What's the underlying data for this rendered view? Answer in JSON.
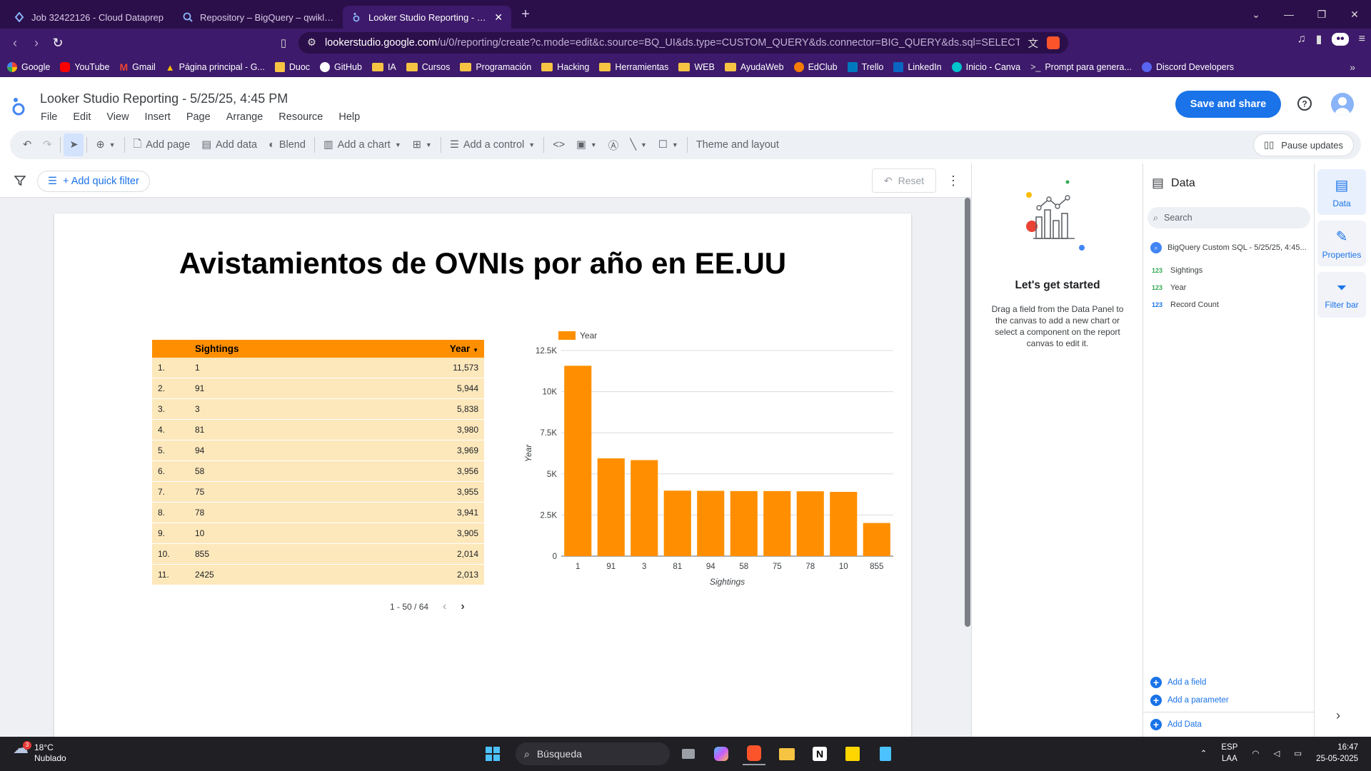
{
  "browser": {
    "tabs": [
      {
        "title": "Job 32422126 - Cloud Dataprep",
        "active": false
      },
      {
        "title": "Repository – BigQuery – qwiklabs-g",
        "active": false
      },
      {
        "title": "Looker Studio Reporting - 5/25",
        "active": true
      }
    ],
    "url_host": "lookerstudio.google.com",
    "url_path": "/u/0/reporting/create?c.mode=edit&c.source=BQ_UI&ds.type=CUSTOM_QUERY&ds.connector=BIG_QUERY&ds.sql=SELECT%20...",
    "bookmarks": [
      "Google",
      "YouTube",
      "Gmail",
      "Página principal - G...",
      "Duoc",
      "GitHub",
      "IA",
      "Cursos",
      "Programación",
      "Hacking",
      "Herramientas",
      "WEB",
      "AyudaWeb",
      "EdClub",
      "Trello",
      "LinkedIn",
      "Inicio - Canva",
      "Prompt para genera...",
      "Discord Developers"
    ]
  },
  "app": {
    "title": "Looker Studio Reporting - 5/25/25, 4:45 PM",
    "menu": [
      "File",
      "Edit",
      "View",
      "Insert",
      "Page",
      "Arrange",
      "Resource",
      "Help"
    ],
    "save_label": "Save and share"
  },
  "toolbar": {
    "add_page": "Add page",
    "add_data": "Add data",
    "blend": "Blend",
    "add_chart": "Add a chart",
    "add_control": "Add a control",
    "theme": "Theme and layout",
    "pause": "Pause updates"
  },
  "filterbar": {
    "quick_filter": "+ Add quick filter",
    "reset": "Reset"
  },
  "report": {
    "title": "Avistamientos de OVNIs por año en EE.UU",
    "table": {
      "headers": [
        "Sightings",
        "Year"
      ],
      "rows": [
        {
          "idx": "1.",
          "sightings": "1",
          "year": "11,573"
        },
        {
          "idx": "2.",
          "sightings": "91",
          "year": "5,944"
        },
        {
          "idx": "3.",
          "sightings": "3",
          "year": "5,838"
        },
        {
          "idx": "4.",
          "sightings": "81",
          "year": "3,980"
        },
        {
          "idx": "5.",
          "sightings": "94",
          "year": "3,969"
        },
        {
          "idx": "6.",
          "sightings": "58",
          "year": "3,956"
        },
        {
          "idx": "7.",
          "sightings": "75",
          "year": "3,955"
        },
        {
          "idx": "8.",
          "sightings": "78",
          "year": "3,941"
        },
        {
          "idx": "9.",
          "sightings": "10",
          "year": "3,905"
        },
        {
          "idx": "10.",
          "sightings": "855",
          "year": "2,014"
        },
        {
          "idx": "11.",
          "sightings": "2425",
          "year": "2,013"
        }
      ],
      "pagination": "1 - 50 / 64"
    }
  },
  "chart_data": {
    "type": "bar",
    "categories": [
      "1",
      "91",
      "3",
      "81",
      "94",
      "58",
      "75",
      "78",
      "10",
      "855"
    ],
    "series": [
      {
        "name": "Year",
        "values": [
          11573,
          5944,
          5838,
          3980,
          3969,
          3956,
          3955,
          3941,
          3905,
          2014
        ]
      }
    ],
    "xlabel": "Sightings",
    "ylabel": "Year",
    "ylim": [
      0,
      12500
    ],
    "yticks": [
      0,
      2500,
      5000,
      7500,
      10000,
      12500
    ],
    "ytick_labels": [
      "0",
      "2.5K",
      "5K",
      "7.5K",
      "10K",
      "12.5K"
    ],
    "grid": true,
    "legend": "top-left",
    "color": "#ff8f00"
  },
  "getstarted": {
    "title": "Let's get started",
    "text": "Drag a field from the Data Panel to the canvas to add a new chart or select a component on the report canvas to edit it."
  },
  "datapanel": {
    "title": "Data",
    "search_placeholder": "Search",
    "source": "BigQuery Custom SQL - 5/25/25, 4:45...",
    "fields": [
      {
        "type": "123",
        "name": "Sightings"
      },
      {
        "type": "123",
        "name": "Year"
      },
      {
        "type": "123",
        "name": "Record Count"
      }
    ],
    "add_field": "Add a field",
    "add_parameter": "Add a parameter",
    "add_data": "Add Data"
  },
  "sidetabs": [
    "Data",
    "Properties",
    "Filter bar"
  ],
  "taskbar": {
    "temp": "18°C",
    "weather": "Nublado",
    "weather_badge": "3",
    "search": "Búsqueda",
    "lang1": "ESP",
    "lang2": "LAA",
    "time": "16:47",
    "date": "25-05-2025"
  }
}
